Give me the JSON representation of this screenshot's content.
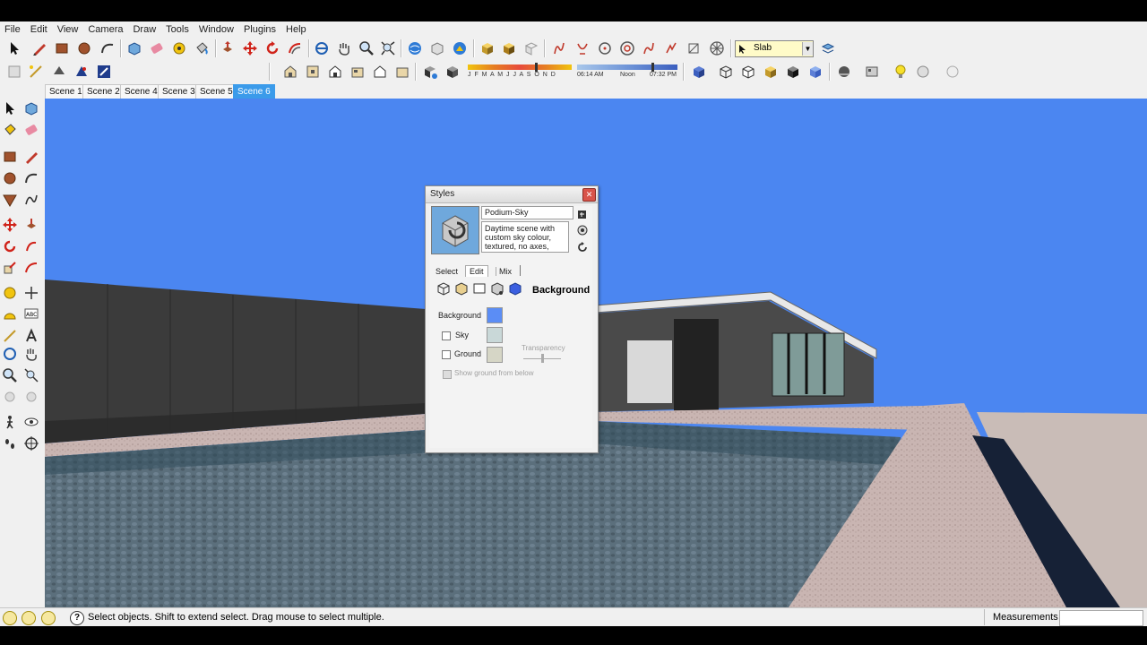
{
  "menubar": {
    "items": [
      "File",
      "Edit",
      "View",
      "Camera",
      "Draw",
      "Tools",
      "Window",
      "Plugins",
      "Help"
    ]
  },
  "toolbar": {
    "layer_select": "Slab",
    "months": "J F M A M J J A S O N D",
    "time_start": "06:14 AM",
    "time_noon": "Noon",
    "time_end": "07:32 PM"
  },
  "scenes": [
    {
      "label": "Scene 1",
      "active": false
    },
    {
      "label": "Scene 2",
      "active": false
    },
    {
      "label": "Scene 4",
      "active": false
    },
    {
      "label": "Scene 3",
      "active": false
    },
    {
      "label": "Scene 5",
      "active": false
    },
    {
      "label": "Scene 6",
      "active": true
    }
  ],
  "styles_dialog": {
    "title": "Styles",
    "style_name": "Podium-Sky",
    "description": "Daytime scene with custom sky colour, textured, no axes,",
    "tabs": [
      "Select",
      "Edit",
      "Mix"
    ],
    "section_title": "Background",
    "background_label": "Background",
    "sky_label": "Sky",
    "ground_label": "Ground",
    "transparency_label": "Transparency",
    "show_ground_label": "Show ground from below",
    "colors": {
      "background": "#5b8df5",
      "sky": "#c9d8d8",
      "ground": "#d6d6c6"
    }
  },
  "status": {
    "hint": "Select objects. Shift to extend select. Drag mouse to select multiple.",
    "measurements_label": "Measurements"
  },
  "colors": {
    "scene_active": "#3b9bea",
    "sky": "#4b86f1"
  }
}
